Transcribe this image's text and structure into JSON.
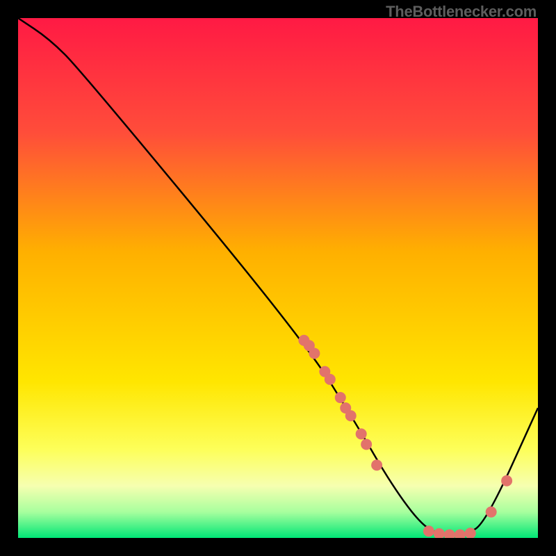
{
  "watermark": "TheBottlenecker.com",
  "chart_data": {
    "type": "line",
    "title": "",
    "xlabel": "",
    "ylabel": "",
    "xlim": [
      0,
      100
    ],
    "ylim": [
      0,
      100
    ],
    "gradient_stops": [
      {
        "offset": 0,
        "color": "#ff1a44"
      },
      {
        "offset": 0.22,
        "color": "#ff4d3a"
      },
      {
        "offset": 0.45,
        "color": "#ffb000"
      },
      {
        "offset": 0.7,
        "color": "#ffe600"
      },
      {
        "offset": 0.83,
        "color": "#fdff5a"
      },
      {
        "offset": 0.9,
        "color": "#f6ffb0"
      },
      {
        "offset": 0.95,
        "color": "#a8ff9e"
      },
      {
        "offset": 1.0,
        "color": "#00e676"
      }
    ],
    "curve": [
      {
        "x": 0,
        "y": 100
      },
      {
        "x": 6,
        "y": 96
      },
      {
        "x": 12,
        "y": 90
      },
      {
        "x": 55,
        "y": 38
      },
      {
        "x": 65,
        "y": 22
      },
      {
        "x": 72,
        "y": 10
      },
      {
        "x": 78,
        "y": 2
      },
      {
        "x": 82,
        "y": 0.5
      },
      {
        "x": 86,
        "y": 0.5
      },
      {
        "x": 90,
        "y": 3
      },
      {
        "x": 100,
        "y": 25
      }
    ],
    "markers": [
      {
        "x": 55,
        "y": 38
      },
      {
        "x": 56,
        "y": 37
      },
      {
        "x": 57,
        "y": 35.5
      },
      {
        "x": 59,
        "y": 32
      },
      {
        "x": 60,
        "y": 30.5
      },
      {
        "x": 62,
        "y": 27
      },
      {
        "x": 63,
        "y": 25
      },
      {
        "x": 64,
        "y": 23.5
      },
      {
        "x": 66,
        "y": 20
      },
      {
        "x": 67,
        "y": 18
      },
      {
        "x": 69,
        "y": 14
      },
      {
        "x": 79,
        "y": 1.3
      },
      {
        "x": 81,
        "y": 0.8
      },
      {
        "x": 83,
        "y": 0.6
      },
      {
        "x": 85,
        "y": 0.6
      },
      {
        "x": 87,
        "y": 0.9
      },
      {
        "x": 91,
        "y": 5
      },
      {
        "x": 94,
        "y": 11
      }
    ],
    "marker_color": "#e2736b",
    "marker_radius": 8
  }
}
